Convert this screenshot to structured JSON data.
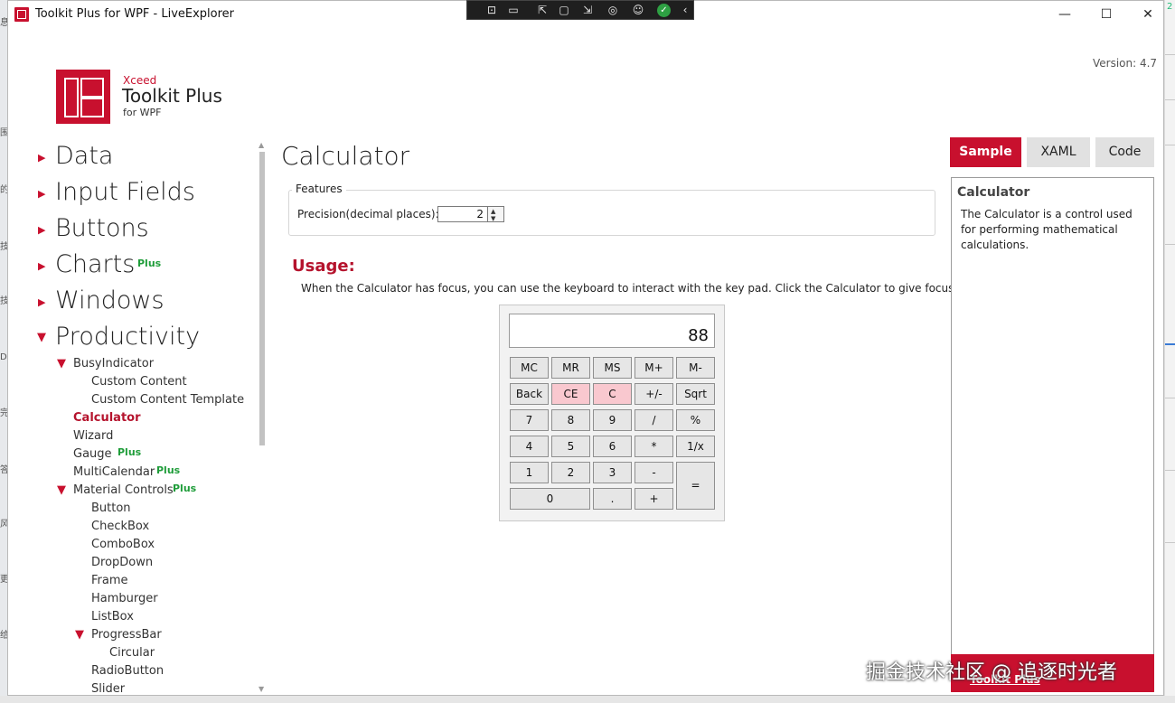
{
  "window": {
    "title": "Toolkit Plus for WPF - LiveExplorer",
    "minimize_glyph": "—",
    "maximize_glyph": "☐",
    "close_glyph": "✕",
    "version": "Version: 4.7"
  },
  "debug_toolbar": {
    "icons": [
      "select-element-icon",
      "display-layout-adorners-icon",
      "track-focus-icon",
      "hot-reload-icon",
      "accessibility-icon",
      "ok-check-icon",
      "collapse-icon"
    ]
  },
  "logo": {
    "brand": "Xceed",
    "product": "Toolkit Plus",
    "platform": "for WPF"
  },
  "nav": {
    "top_items": [
      {
        "label": "Data"
      },
      {
        "label": "Input Fields"
      },
      {
        "label": "Buttons"
      },
      {
        "label": "Charts",
        "badge": "Plus"
      },
      {
        "label": "Windows"
      },
      {
        "label": "Productivity"
      }
    ],
    "sub_items": [
      {
        "label": "BusyIndicator"
      },
      {
        "label": "Custom Content"
      },
      {
        "label": "Custom Content Template"
      },
      {
        "label": "Calculator",
        "selected": true
      },
      {
        "label": "Wizard"
      },
      {
        "label": "Gauge",
        "badge": "Plus"
      },
      {
        "label": "MultiCalendar",
        "badge": "Plus"
      },
      {
        "label": "Material Controls",
        "badge": "Plus"
      },
      {
        "label": "Button"
      },
      {
        "label": "CheckBox"
      },
      {
        "label": "ComboBox"
      },
      {
        "label": "DropDown"
      },
      {
        "label": "Frame"
      },
      {
        "label": "Hamburger"
      },
      {
        "label": "ListBox"
      },
      {
        "label": "ProgressBar"
      },
      {
        "label": "Circular"
      },
      {
        "label": "RadioButton"
      },
      {
        "label": "Slider"
      }
    ]
  },
  "main": {
    "title": "Calculator",
    "features_legend": "Features",
    "precision_label": "Precision(decimal places):",
    "precision_value": "2",
    "usage_title": "Usage:",
    "usage_text": "When the Calculator has focus, you can use the keyboard to interact with the key pad. Click the Calculator to give focus."
  },
  "calculator": {
    "display": "88",
    "keys": {
      "mc": "MC",
      "mr": "MR",
      "ms": "MS",
      "mplus": "M+",
      "mminus": "M-",
      "back": "Back",
      "ce": "CE",
      "c": "C",
      "negate": "+/-",
      "sqrt": "Sqrt",
      "k7": "7",
      "k8": "8",
      "k9": "9",
      "divide": "/",
      "percent": "%",
      "k4": "4",
      "k5": "5",
      "k6": "6",
      "multiply": "*",
      "reciprocal": "1/x",
      "k1": "1",
      "k2": "2",
      "k3": "3",
      "minus": "-",
      "equals": "=",
      "k0": "0",
      "decimal": ".",
      "plus": "+"
    }
  },
  "tabs": {
    "sample": "Sample",
    "xaml": "XAML",
    "code": "Code"
  },
  "description": {
    "title": "Calculator",
    "text": "The Calculator is a control used for performing mathematical calculations.",
    "footer": "Toolkit Plus"
  },
  "watermark": "掘金技术社区 @ 追逐时光者",
  "colors": {
    "accent": "#c8102e",
    "plus_badge": "#1f9d3a",
    "key_red": "#f9c8cf"
  }
}
